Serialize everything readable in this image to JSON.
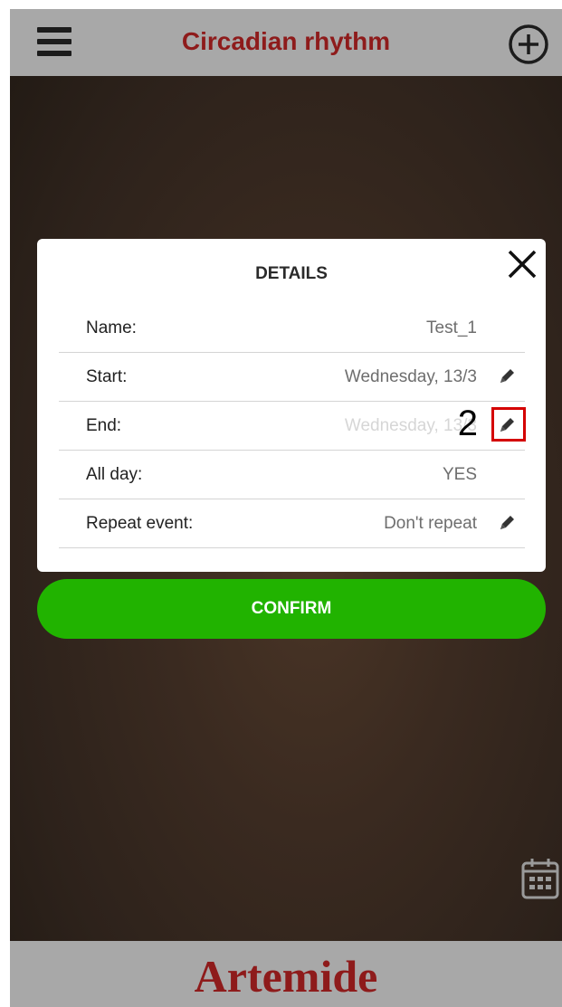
{
  "header": {
    "title": "Circadian rhythm",
    "menu_icon": "hamburger-menu-icon",
    "add_icon": "circle-plus-icon"
  },
  "dialog": {
    "title": "DETAILS",
    "close_icon": "close-x-icon",
    "rows": [
      {
        "label": "Name:",
        "value": "Test_1",
        "editable": false
      },
      {
        "label": "Start:",
        "value": "Wednesday, 13/3",
        "editable": true
      },
      {
        "label": "End:",
        "value": "Wednesday, 13/3",
        "editable": true,
        "highlighted": true,
        "step": "2"
      },
      {
        "label": "All day:",
        "value": "YES",
        "editable": false
      },
      {
        "label": "Repeat event:",
        "value": "Don't repeat",
        "editable": true
      }
    ]
  },
  "confirm": {
    "label": "CONFIRM"
  },
  "footer": {
    "brand": "Artemide",
    "calendar_icon": "calendar-icon"
  },
  "colors": {
    "brand_red": "#8e1b1b",
    "confirm_green": "#21b300",
    "bar_gray": "#a8a8a8",
    "highlight_red": "#d40000"
  }
}
